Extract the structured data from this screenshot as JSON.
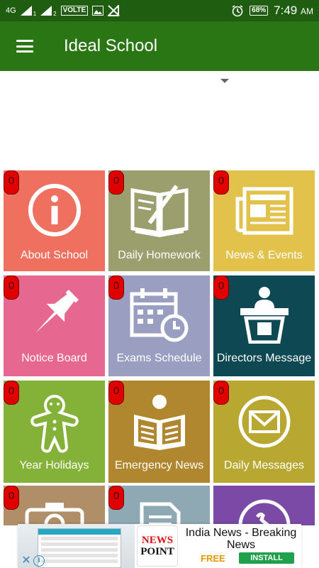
{
  "status_bar": {
    "network": "4G",
    "sim1": "1",
    "sim2": "2",
    "volte": "VOLTE",
    "battery": "68%",
    "time": "7:49",
    "ampm": "AM"
  },
  "app_bar": {
    "menu_icon": "hamburger-menu-icon",
    "title": "Ideal School"
  },
  "dropdown": {
    "arrow_icon": "dropdown-arrow-icon"
  },
  "tiles": [
    {
      "label": "About School",
      "badge": "0",
      "color": "#f07060",
      "icon": "info-icon"
    },
    {
      "label": "Daily Homework",
      "badge": "0",
      "color": "#9b9f6e",
      "icon": "open-book-pencil-icon"
    },
    {
      "label": "News & Events",
      "badge": "0",
      "color": "#e3c24c",
      "icon": "newspaper-icon"
    },
    {
      "label": "Notice Board",
      "badge": "0",
      "color": "#e66891",
      "icon": "pushpin-icon"
    },
    {
      "label": "Exams Schedule",
      "badge": "0",
      "color": "#9a9ec0",
      "icon": "calendar-clock-icon"
    },
    {
      "label": "Directors Message",
      "badge": "0",
      "color": "#0e4852",
      "icon": "speaker-podium-icon"
    },
    {
      "label": "Year Holidays",
      "badge": "0",
      "color": "#84b238",
      "icon": "gingerbread-man-icon"
    },
    {
      "label": "Emergency News",
      "badge": "0",
      "color": "#b0862e",
      "icon": "person-reading-news-icon"
    },
    {
      "label": "Daily Messages",
      "badge": "0",
      "color": "#b8a832",
      "icon": "envelope-icon"
    },
    {
      "label": "",
      "badge": "0",
      "color": "#b08e68",
      "icon": "camera-icon"
    },
    {
      "label": "",
      "badge": "0",
      "color": "#8fa9b4",
      "icon": "document-icon"
    },
    {
      "label": "",
      "badge": "",
      "color": "#7a4aa6",
      "icon": "phone-icon"
    }
  ],
  "ad": {
    "logo_line1": "NEWS",
    "logo_line2": "POINT",
    "title": "India News - Breaking News",
    "price": "FREE",
    "cta": "INSTALL",
    "close_icon": "close-icon",
    "info_icon": "info-icon"
  }
}
